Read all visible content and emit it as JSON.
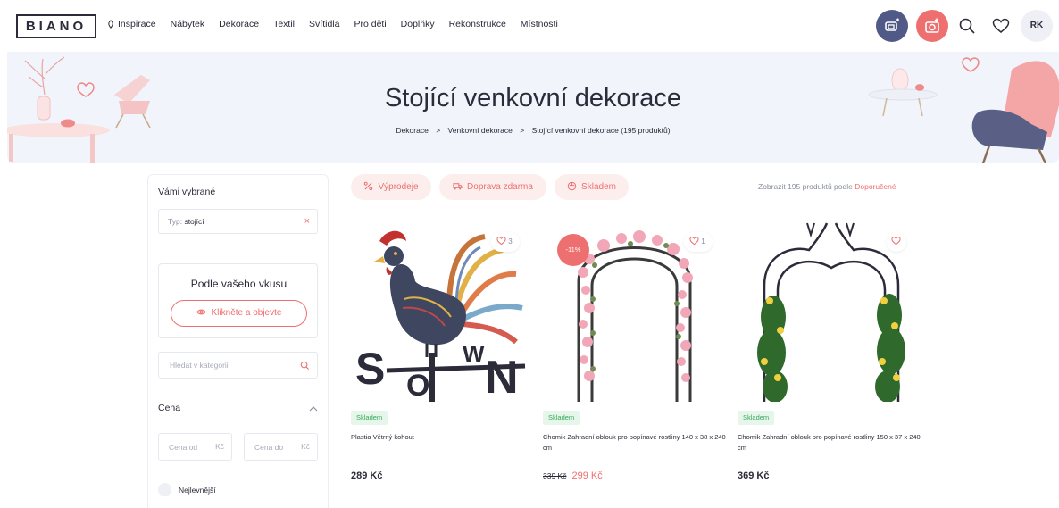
{
  "header": {
    "logo": "BIANO",
    "nav": [
      "Inspirace",
      "Nábytek",
      "Dekorace",
      "Textil",
      "Svítidla",
      "Pro děti",
      "Doplňky",
      "Rekonstrukce",
      "Místnosti"
    ],
    "avatar_initials": "RK"
  },
  "hero": {
    "title": "Stojící venkovní dekorace",
    "breadcrumb": [
      "Dekorace",
      "Venkovní dekorace",
      "Stojící venkovní dekorace (195 produktů)"
    ],
    "separator": ">"
  },
  "sidebar": {
    "selected_title": "Vámi vybrané",
    "chip": {
      "label": "Typ:",
      "value": "stojící",
      "remove": "×"
    },
    "taste_title": "Podle vašeho vkusu",
    "taste_button": "Klikněte a objevte",
    "category_search_placeholder": "Hledat v kategorii",
    "price_title": "Cena",
    "price_from_placeholder": "Cena od",
    "price_to_placeholder": "Cena do",
    "currency": "Kč",
    "sort_option": "Nejlevnější"
  },
  "filters": {
    "sale": "Výprodeje",
    "free_shipping": "Doprava zdarma",
    "in_stock": "Skladem"
  },
  "sort_info": {
    "prefix": "Zobrazit 195 produktů podle",
    "value": "Doporučené"
  },
  "products": [
    {
      "stock": "Skladem",
      "name": "Plastia Větrný kohout",
      "price": "289 Kč",
      "likes": "3"
    },
    {
      "stock": "Skladem",
      "name": "Chomik Zahradní oblouk pro popínavé rostliny 140 x 38 x 240 cm",
      "old_price": "339 Kč",
      "price": "299 Kč",
      "discount": "-11%",
      "likes": "1"
    },
    {
      "stock": "Skladem",
      "name": "Chomik Zahradní oblouk pro popínavé rostliny 150 x 37 x 240 cm",
      "price": "369 Kč"
    }
  ],
  "colors": {
    "accent": "#ee6f6f",
    "navy": "#515a86",
    "stock_green": "#36a85a",
    "hero_bg": "#f1f4fb"
  },
  "icons": [
    "inspiration-icon",
    "room-planner-icon",
    "photo-search-icon",
    "search-icon",
    "heart-icon",
    "eye-icon",
    "close-icon",
    "chevron-up-icon",
    "percent-icon",
    "truck-icon",
    "box-icon"
  ]
}
